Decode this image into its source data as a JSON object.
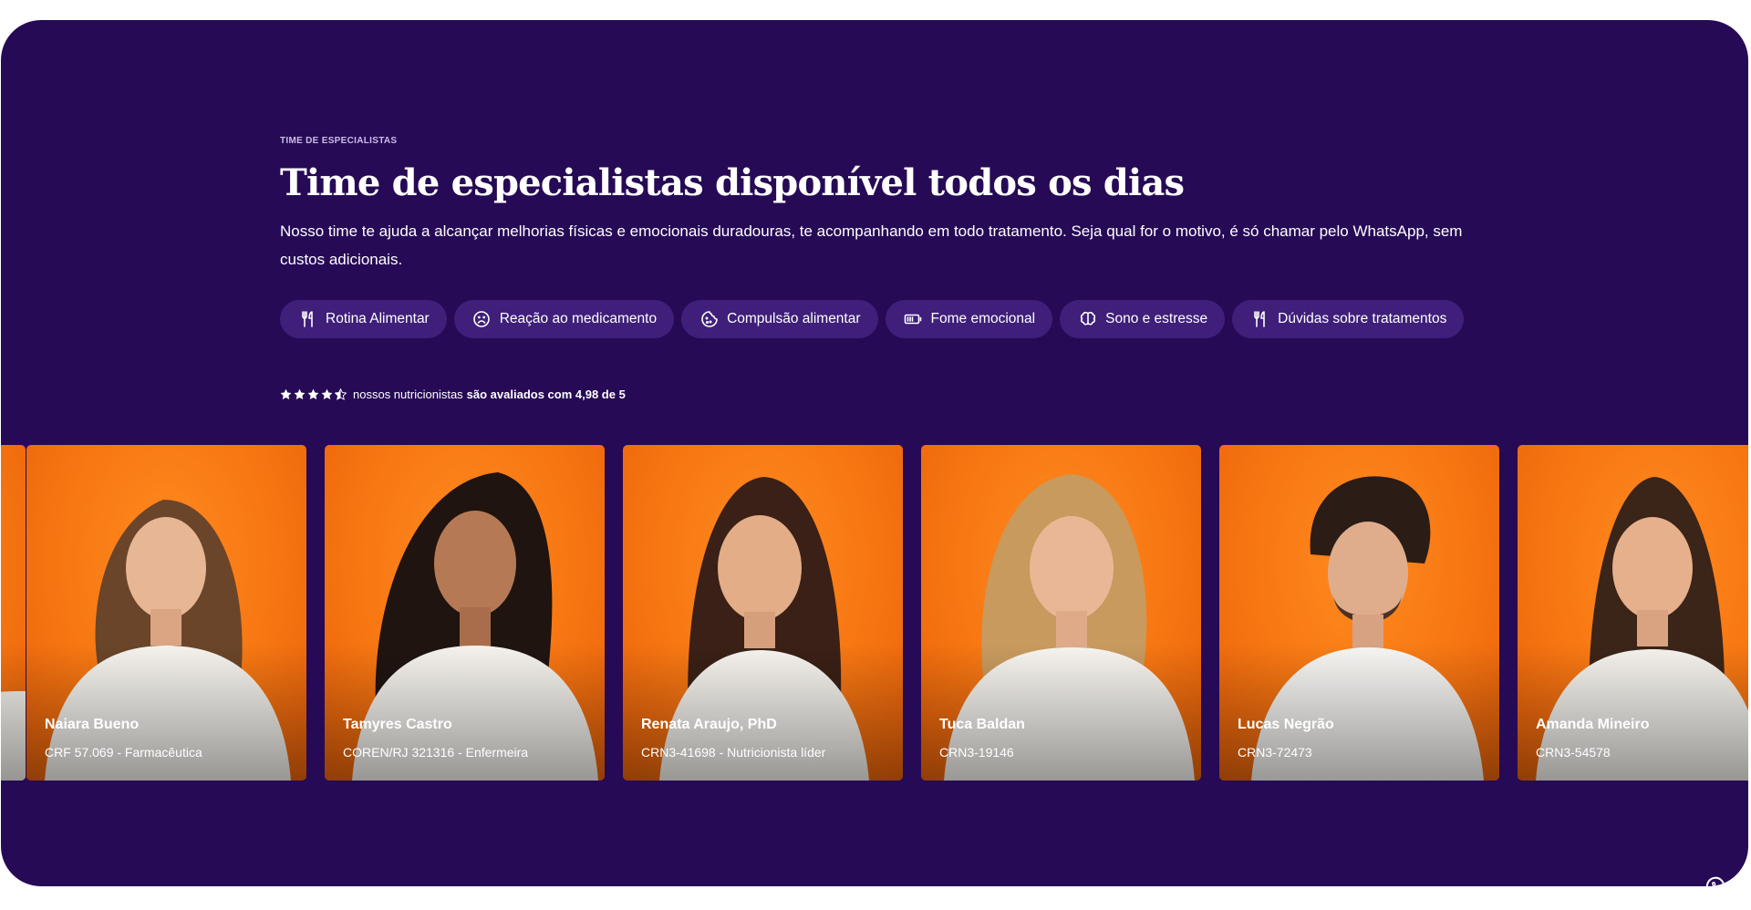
{
  "section": {
    "eyebrow": "TIME DE ESPECIALISTAS",
    "title": "Time de especialistas disponível todos os dias",
    "description": "Nosso time te ajuda a alcançar melhorias físicas e emocionais duradouras, te acompanhando em todo tratamento. Seja qual for o motivo, é só chamar pelo WhatsApp, sem custos adicionais."
  },
  "chips": [
    {
      "label": "Rotina Alimentar",
      "icon": "fork-knife-icon"
    },
    {
      "label": "Reação ao medicamento",
      "icon": "sad-face-icon"
    },
    {
      "label": "Compulsão alimentar",
      "icon": "cookie-icon"
    },
    {
      "label": "Fome emocional",
      "icon": "battery-icon"
    },
    {
      "label": "Sono e estresse",
      "icon": "brain-icon"
    },
    {
      "label": "Dúvidas sobre tratamentos",
      "icon": "fork-knife-icon"
    }
  ],
  "rating": {
    "stars": 4.98,
    "text": "nossos nutricionistas",
    "emphasis": "são avaliados com 4,98 de 5"
  },
  "specialists": [
    {
      "name": "Naiara Bueno",
      "credential": "CRF 57.069 - Farmacêutica"
    },
    {
      "name": "Tamyres Castro",
      "credential": "COREN/RJ 321316 - Enfermeira"
    },
    {
      "name": "Renata Araujo, PhD",
      "credential": "CRN3-41698 - Nutricionista líder"
    },
    {
      "name": "Tuca Baldan",
      "credential": "CRN3-19146"
    },
    {
      "name": "Lucas Negrão",
      "credential": "CRN3-72473"
    },
    {
      "name": "Amanda Mineiro",
      "credential": "CRN3-54578"
    }
  ],
  "colors": {
    "background": "#260a56",
    "chip": "#3f1f7a",
    "card": "#f77612",
    "text": "#ffffff"
  },
  "whatsapp_button": {
    "icon": "whatsapp-icon"
  }
}
